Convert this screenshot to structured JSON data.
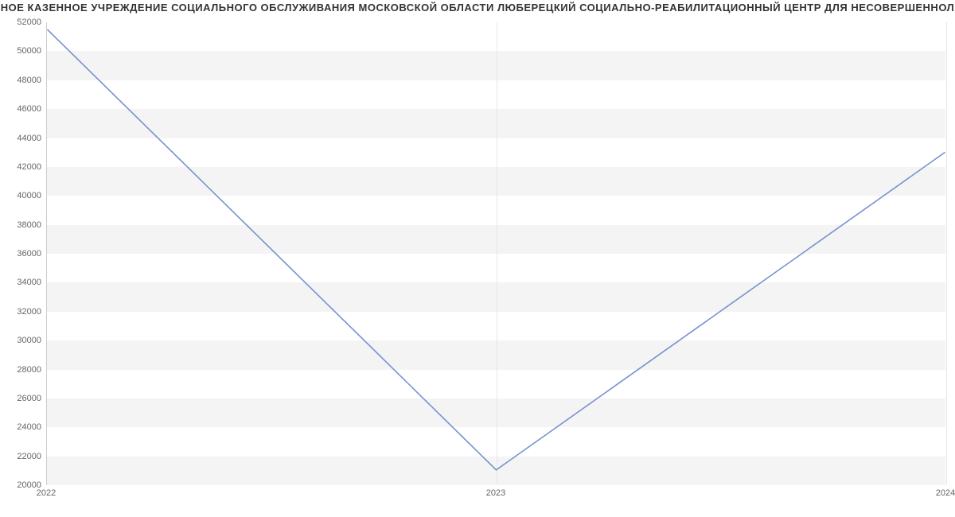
{
  "chart_data": {
    "type": "line",
    "title": "НОЕ КАЗЕННОЕ УЧРЕЖДЕНИЕ СОЦИАЛЬНОГО ОБСЛУЖИВАНИЯ МОСКОВСКОЙ ОБЛАСТИ ЛЮБЕРЕЦКИЙ СОЦИАЛЬНО-РЕАБИЛИТАЦИОННЫЙ ЦЕНТР ДЛЯ НЕСОВЕРШЕННОЛ",
    "categories": [
      "2022",
      "2023",
      "2024"
    ],
    "x": [
      2022,
      2023,
      2024
    ],
    "series": [
      {
        "name": "s1",
        "values": [
          51500,
          21000,
          43000
        ]
      }
    ],
    "xlabel": "",
    "ylabel": "",
    "ylim": [
      20000,
      52000
    ],
    "y_ticks": [
      20000,
      22000,
      24000,
      26000,
      28000,
      30000,
      32000,
      34000,
      36000,
      38000,
      40000,
      42000,
      44000,
      46000,
      48000,
      50000,
      52000
    ],
    "line_color": "#7991d0"
  }
}
